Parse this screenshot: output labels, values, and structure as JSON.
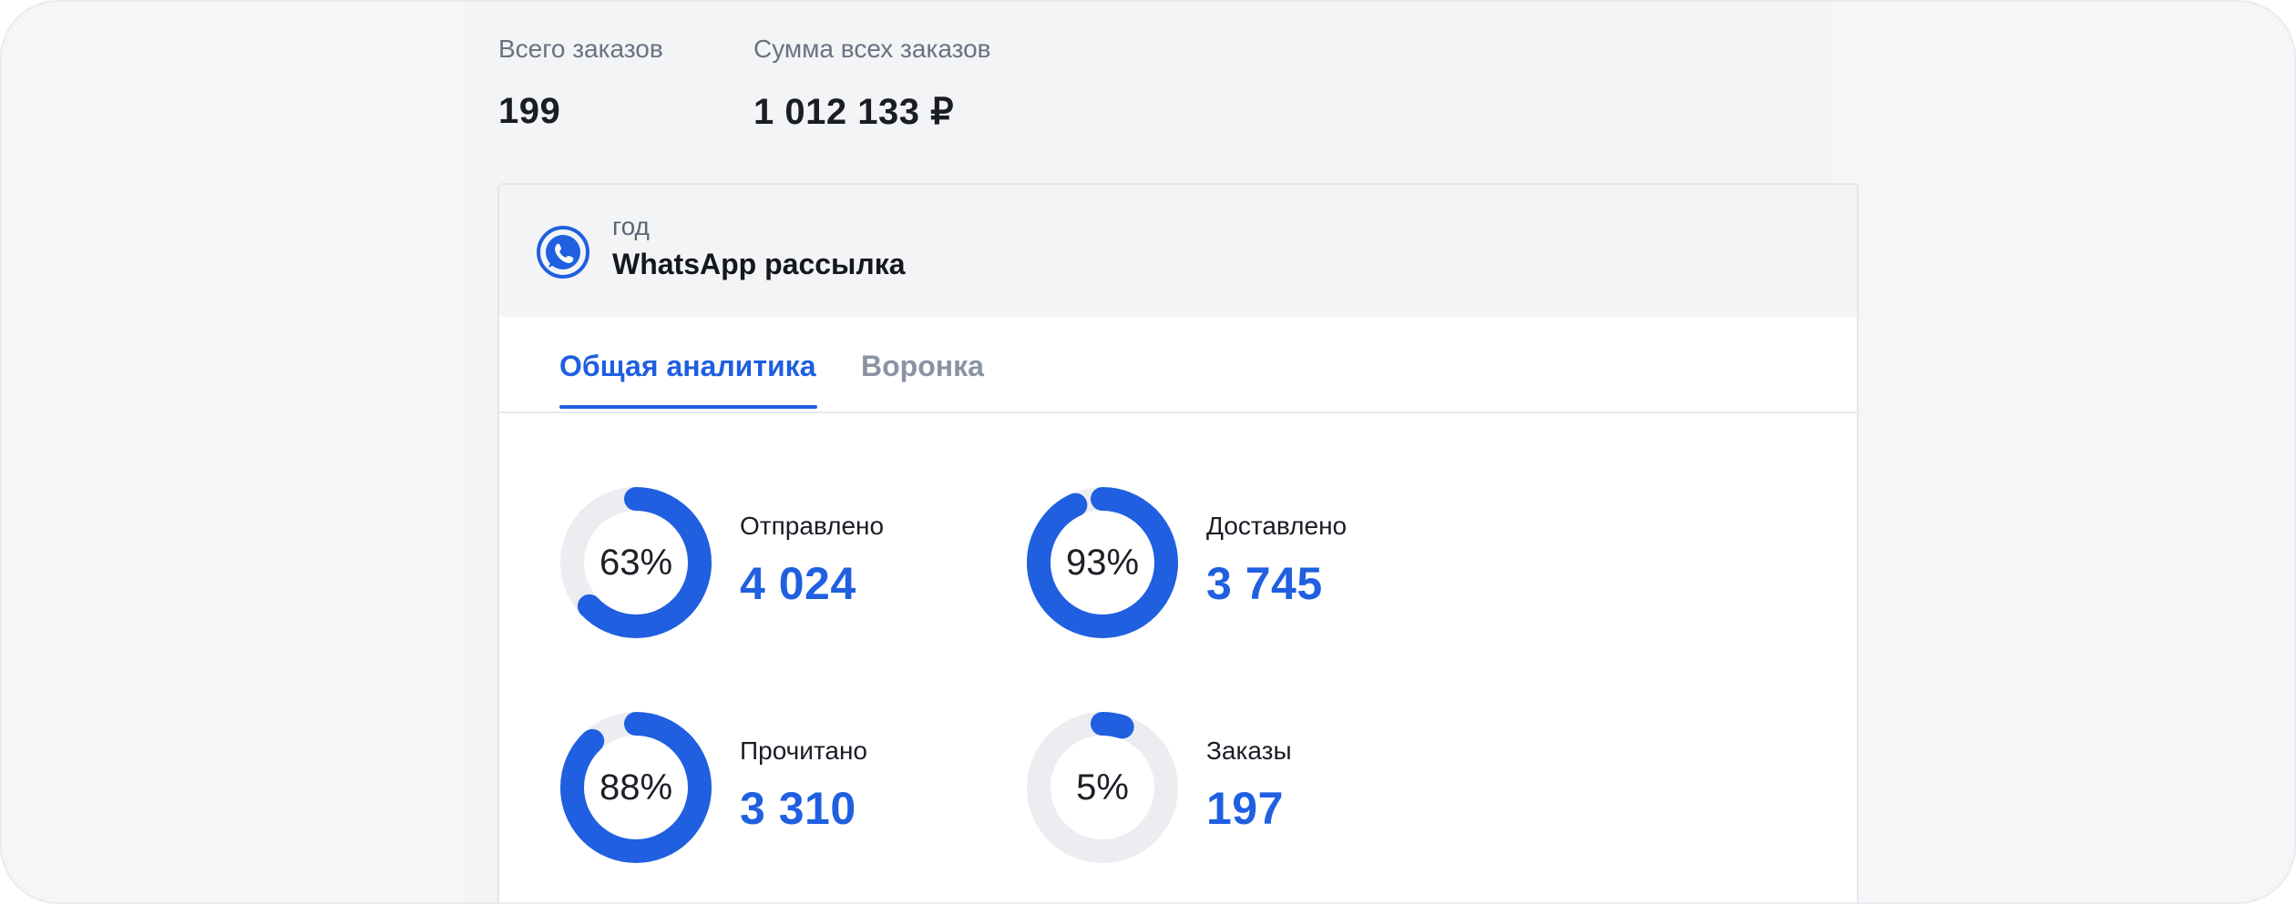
{
  "stats": [
    {
      "label": "Всего заказов",
      "value": "199"
    },
    {
      "label": "Сумма всех заказов",
      "value": "1 012 133 ₽"
    }
  ],
  "campaign": {
    "period": "год",
    "title": "WhatsApp рассылка",
    "icon": "whatsapp-icon"
  },
  "tabs": [
    {
      "label": "Общая аналитика",
      "active": true
    },
    {
      "label": "Воронка",
      "active": false
    }
  ],
  "metrics": [
    {
      "label": "Отправлено",
      "value": "4 024",
      "percent_text": "63%",
      "percent": 63
    },
    {
      "label": "Доставлено",
      "value": "3 745",
      "percent_text": "93%",
      "percent": 93
    },
    {
      "label": "Прочитано",
      "value": "3 310",
      "percent_text": "88%",
      "percent": 88
    },
    {
      "label": "Заказы",
      "value": "197",
      "percent_text": "5%",
      "percent": 5
    }
  ],
  "colors": {
    "accent": "#1f5fe0",
    "track": "#ebedf0"
  }
}
